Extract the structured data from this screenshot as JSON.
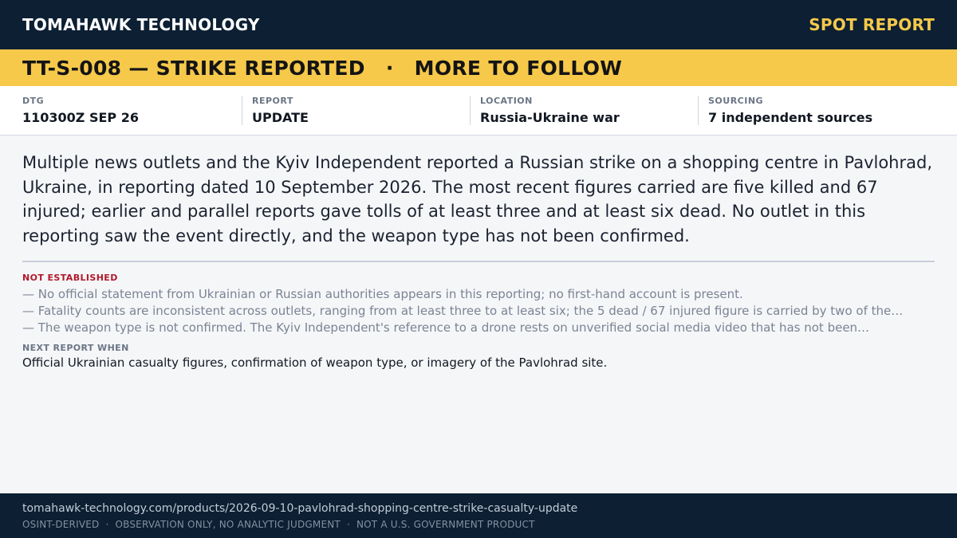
{
  "header": {
    "brand": "TOMAHAWK TECHNOLOGY",
    "report_kind": "SPOT REPORT"
  },
  "banner": {
    "id_status": "TT-S-008 — STRIKE REPORTED",
    "separator": "·",
    "follow": "MORE TO FOLLOW"
  },
  "meta": [
    {
      "label": "DTG",
      "value": "110300Z SEP 26"
    },
    {
      "label": "REPORT",
      "value": "UPDATE"
    },
    {
      "label": "LOCATION",
      "value": "Russia-Ukraine war"
    },
    {
      "label": "SOURCING",
      "value": "7 independent sources"
    }
  ],
  "summary": "Multiple news outlets and the Kyiv Independent reported a Russian strike on a shopping centre in Pavlohrad, Ukraine, in reporting dated 10 September 2026. The most recent figures carried are five killed and 67 injured; earlier and parallel reports gave tolls of at least three and at least six dead. No outlet in this reporting saw the event directly, and the weapon type has not been confirmed.",
  "not_established": {
    "title": "NOT ESTABLISHED",
    "items": [
      "— No official statement from Ukrainian or Russian authorities appears in this reporting; no first-hand account is present.",
      "— Fatality counts are inconsistent across outlets, ranging from at least three to at least six; the 5 dead / 67 injured figure is carried by two of the…",
      "— The weapon type is not confirmed. The Kyiv Independent's reference to a drone rests on unverified social media video that has not been…"
    ]
  },
  "next_report": {
    "title": "NEXT REPORT WHEN",
    "text": "Official Ukrainian casualty figures, confirmation of weapon type, or imagery of the Pavlohrad site."
  },
  "footer": {
    "url": "tomahawk-technology.com/products/2026-09-10-pavlohrad-shopping-centre-strike-casualty-update",
    "disclaimers": [
      "OSINT-DERIVED",
      "OBSERVATION ONLY, NO ANALYTIC JUDGMENT",
      "NOT A U.S. GOVERNMENT PRODUCT"
    ],
    "separator": "·"
  }
}
